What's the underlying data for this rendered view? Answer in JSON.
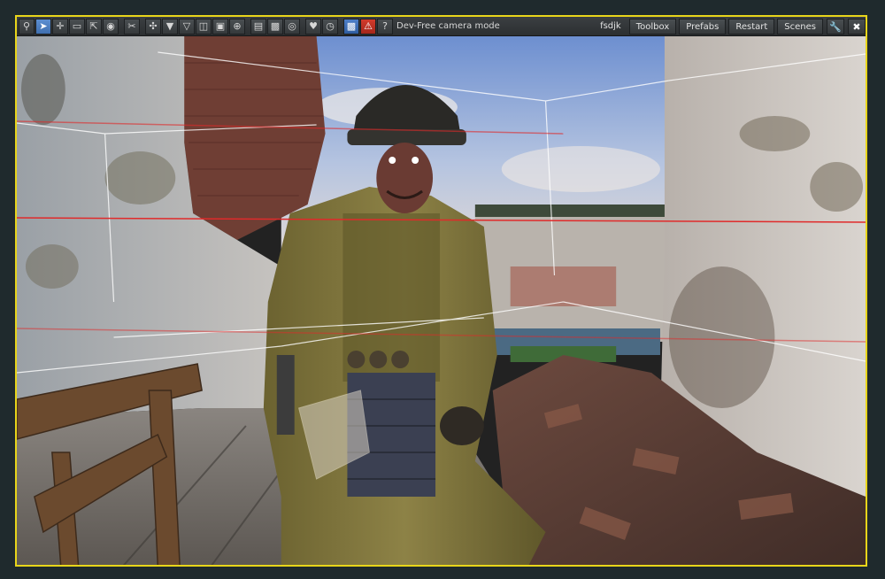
{
  "toolbar": {
    "mode_label": "Dev-Free camera mode",
    "user_tag": "fsdjk",
    "menus": [
      "Toolbox",
      "Prefabs",
      "Restart",
      "Scenes"
    ]
  },
  "icons": {
    "left": [
      "search-icon",
      "select-arrow-icon",
      "move-icon",
      "rect-select-icon",
      "scale-icon",
      "globe-icon",
      "scissors-icon",
      "navigate-icon",
      "arrow-down-icon",
      "arrow-down-outline-icon",
      "panel-icon",
      "car-icon",
      "target-icon",
      "page-icon",
      "camera-icon",
      "eye-icon",
      "heart-icon",
      "clock-icon",
      "save-icon",
      "warning-icon",
      "help-icon"
    ],
    "right": [
      "wrench-icon",
      "close-icon"
    ]
  },
  "colors": {
    "frame_border": "#e8d51a",
    "toolbar_bg": "#33373a",
    "active_button": "#4f82c6",
    "warning_button": "#c9321f"
  }
}
